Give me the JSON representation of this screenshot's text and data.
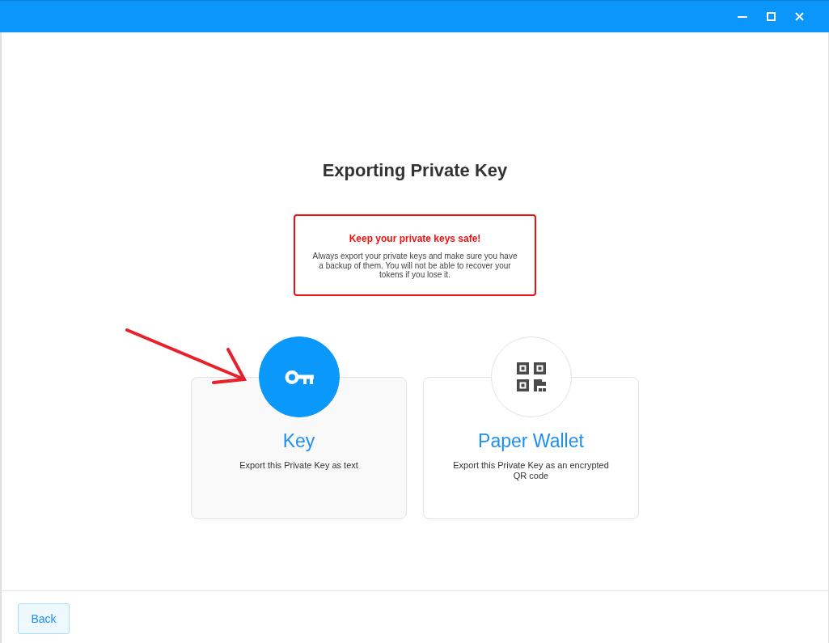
{
  "heading": "Exporting Private Key",
  "warning": {
    "title": "Keep your private keys safe!",
    "text": "Always export your private keys and make sure you have a backup of them. You will not be able to recover your tokens if you lose it."
  },
  "options": [
    {
      "kind": "key",
      "title": "Key",
      "description": "Export this Private Key as text",
      "selected": true
    },
    {
      "kind": "qr",
      "title": "Paper Wallet",
      "description": "Export this Private Key as an encrypted QR code",
      "selected": false
    }
  ],
  "footer": {
    "back_button": "Back"
  }
}
